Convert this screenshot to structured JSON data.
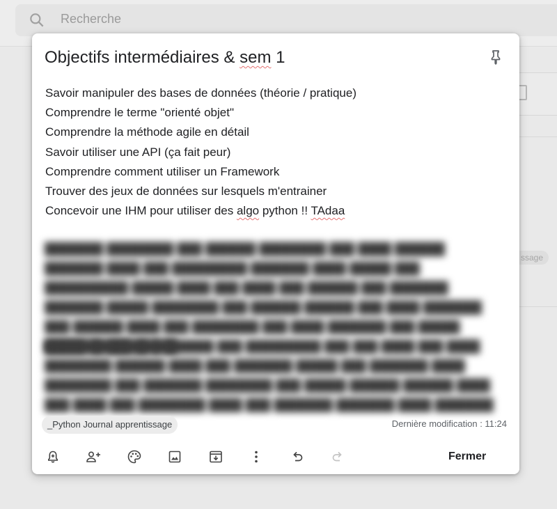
{
  "search": {
    "placeholder": "Recherche"
  },
  "background": {
    "chip_fragment": "ssage"
  },
  "note": {
    "title_main": "Objectifs intermédiaires & ",
    "title_squiggle": "sem",
    "title_end": " 1",
    "lines": [
      "Savoir manipuler des bases de données (théorie / pratique)",
      "Comprendre le terme \"orienté objet\"",
      "Comprendre la méthode agile en détail",
      "Savoir utiliser une API (ça fait peur)",
      "Comprendre comment utiliser un Framework",
      "Trouver des jeux de données sur lesquels m'entrainer"
    ],
    "last_line": {
      "before": "Concevoir une IHM pour utiliser des ",
      "squiggle1": "algo",
      "middle": " python !! ",
      "squiggle2": "TAdaa"
    },
    "label": "_Python Journal apprentissage",
    "modified": "Dernière modification : 11:24",
    "toolbar": {
      "icons": [
        "reminder-bell-icon",
        "collaborator-icon",
        "palette-icon",
        "image-icon",
        "archive-icon",
        "more-vert-icon",
        "undo-icon",
        "redo-icon"
      ],
      "close_label": "Fermer"
    }
  }
}
